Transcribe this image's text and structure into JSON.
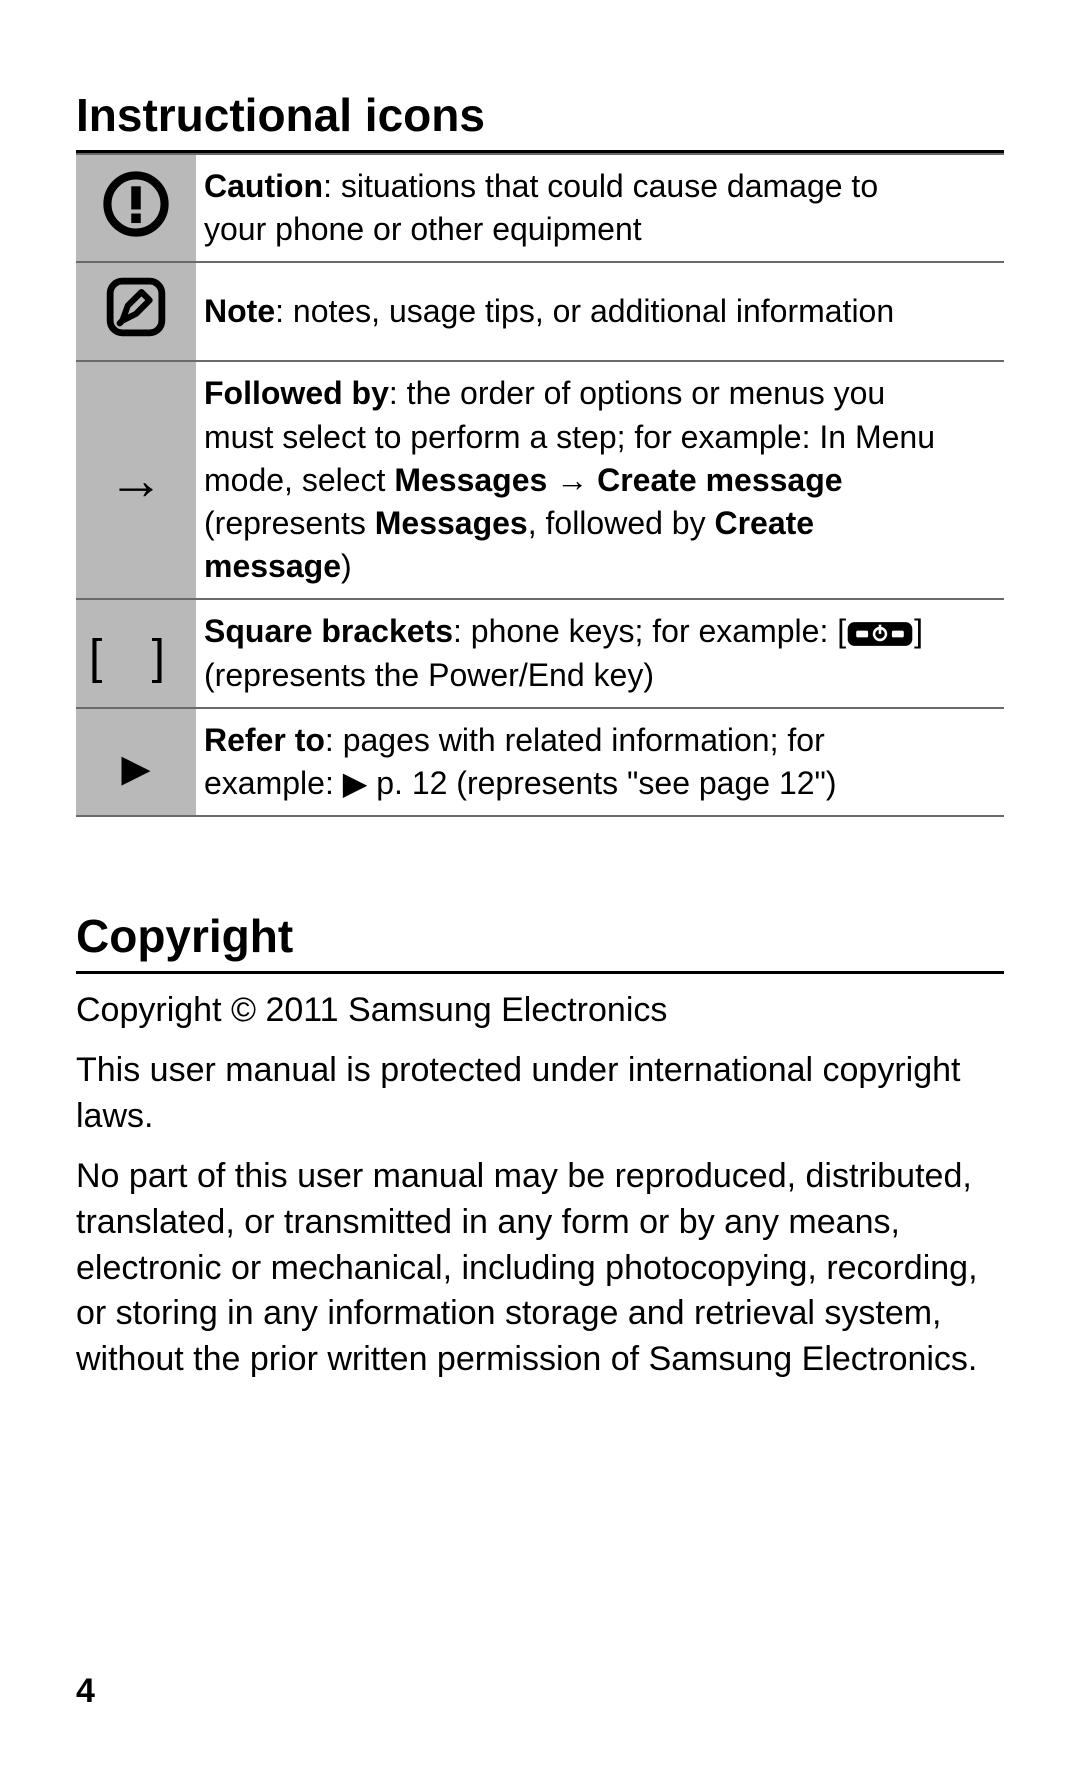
{
  "section1": {
    "title": "Instructional icons",
    "rows": [
      {
        "icon": "caution-icon",
        "label": "Caution",
        "text": ": situations that could cause damage to your phone or other equipment"
      },
      {
        "icon": "note-icon",
        "label": "Note",
        "text": ": notes, usage tips, or additional information"
      },
      {
        "icon": "arrow-right-icon",
        "label": "Followed by",
        "text_a": ": the order of options or menus you must select to perform a step; for example: In Menu mode, select ",
        "bold_a": "Messages",
        "arrow": " → ",
        "bold_b": "Create message",
        "text_b": " (represents ",
        "bold_c": "Messages",
        "text_c": ", followed by ",
        "bold_d": "Create message",
        "text_d": ")"
      },
      {
        "icon": "square-brackets-icon",
        "label": "Square brackets",
        "text_a": ": phone keys; for example: [",
        "text_b": "] (represents the Power/End key)"
      },
      {
        "icon": "refer-to-icon",
        "label": "Refer to",
        "text_a": ": pages with related information; for example: ",
        "tri": "▶",
        "text_b": " p. 12 (represents \"see page 12\")"
      }
    ]
  },
  "section2": {
    "title": "Copyright",
    "line1": "Copyright © 2011 Samsung Electronics",
    "line2": "This user manual is protected under international copyright laws.",
    "line3": "No part of this user manual may be reproduced, distributed, translated, or transmitted in any form or by any means, electronic or mechanical, including photocopying, recording, or storing in any information storage and retrieval system, without the prior written permission of Samsung Electronics."
  },
  "page_number": "4"
}
